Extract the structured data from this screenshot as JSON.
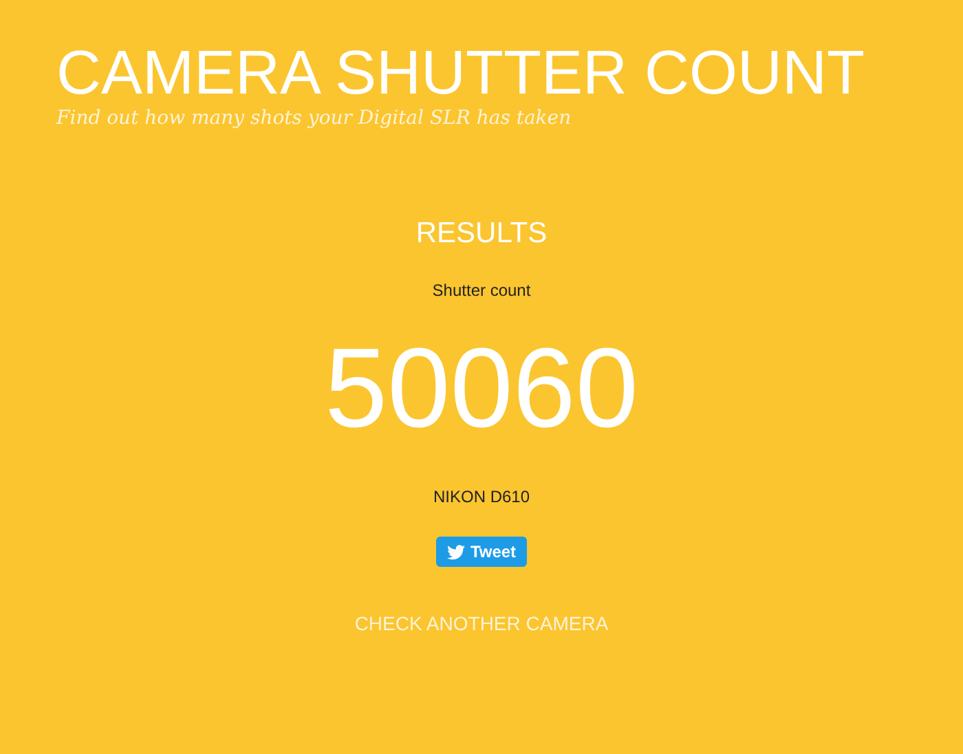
{
  "header": {
    "title": "CAMERA SHUTTER COUNT",
    "subtitle": "Find out how many shots your Digital SLR has taken"
  },
  "results": {
    "heading": "RESULTS",
    "label": "Shutter count",
    "count": "50060",
    "camera": "NIKON D610",
    "tweet_button": "Tweet",
    "link": "CHECK ANOTHER CAMERA"
  }
}
